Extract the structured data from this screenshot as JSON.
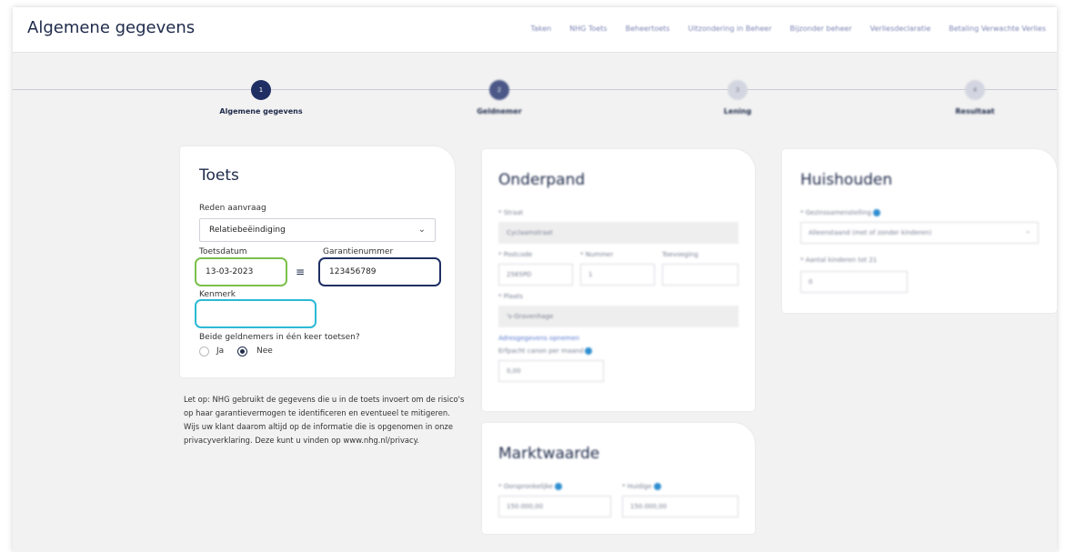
{
  "header": {
    "title": "Algemene gegevens",
    "nav": [
      "Taken",
      "NHG Toets",
      "Beheertoets",
      "Uitzondering in Beheer",
      "Bijzonder beheer",
      "Verliesdeclaratie",
      "Betaling Verwachte Verlies"
    ]
  },
  "steps": [
    {
      "number": "1",
      "label": "Algemene gegevens"
    },
    {
      "number": "2",
      "label": "Geldnemer"
    },
    {
      "number": "3",
      "label": "Lening"
    },
    {
      "number": "4",
      "label": "Resultaat"
    }
  ],
  "toets": {
    "title": "Toets",
    "reden_label": "Reden aanvraag",
    "reden_value": "Relatiebeëindiging",
    "toetsdatum_label": "Toetsdatum",
    "toetsdatum_value": "13-03-2023",
    "garantienummer_label": "Garantienummer",
    "garantienummer_value": "123456789",
    "kenmerk_label": "Kenmerk",
    "kenmerk_value": "",
    "beide_label": "Beide geldnemers in één keer toetsen?",
    "option_ja": "Ja",
    "option_nee": "Nee",
    "selected": "Nee"
  },
  "note": "Let op: NHG gebruikt de gegevens die u in de toets invoert om de risico's op haar garantievermogen te identificeren en eventueel te mitigeren. Wijs uw klant daarom altijd op de informatie die is opgenomen in onze privacyverklaring. Deze kunt u vinden op www.nhg.nl/privacy.",
  "onderpand": {
    "title": "Onderpand",
    "straat_label": "* Straat",
    "straat_value": "Cyclaamstraat",
    "postcode_label": "* Postcode",
    "postcode_value": "2565PD",
    "nummer_label": "* Nummer",
    "nummer_value": "1",
    "toevoeging_label": "Toevoeging",
    "plaats_label": "* Plaats",
    "plaats_value": "'s-Gravenhage",
    "link": "Adresgegevens opnemen",
    "erfpacht_label": "Erfpacht canon per maand",
    "erfpacht_value": "0,00"
  },
  "marktwaarde": {
    "title": "Marktwaarde",
    "oorspronkelijke_label": "* Oorspronkelijke",
    "oorspronkelijke_value": "150.000,00",
    "huidige_label": "* Huidige",
    "huidige_value": "150.000,00"
  },
  "huishouden": {
    "title": "Huishouden",
    "samenstelling_label": "* Gezinssamenstelling",
    "samenstelling_value": "Alleenstaand (met of zonder kinderen)",
    "kinderen_label": "* Aantal kinderen tot 21",
    "kinderen_value": "0"
  },
  "colors": {
    "navy": "#1f2f63",
    "green": "#7cc04b",
    "cyan": "#2bbad4",
    "info": "#2f8fd0"
  }
}
